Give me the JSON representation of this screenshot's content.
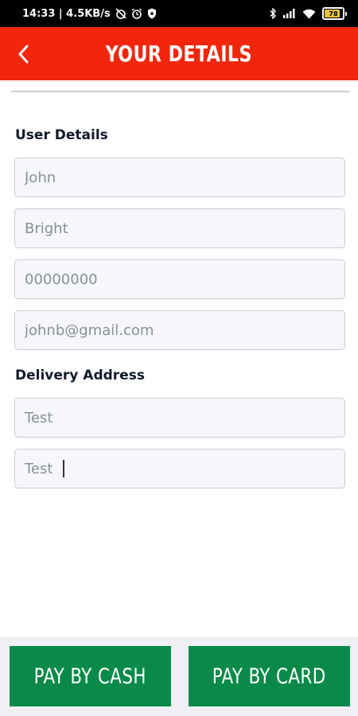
{
  "status_bar": {
    "time_speed": "14:33 | 4.5KB/s",
    "battery": "78",
    "icons": [
      "alarm-off-icon",
      "alarm-icon",
      "shield-icon",
      "bluetooth-icon",
      "signal-icon",
      "wifi-icon",
      "battery-icon"
    ]
  },
  "header": {
    "title": "YOUR DETAILS",
    "back_icon": "chevron-left-icon",
    "background": "#f1260c"
  },
  "user_details": {
    "heading": "User Details",
    "first_name": "John",
    "last_name": "Bright",
    "phone": "00000000",
    "email": "johnb@gmail.com"
  },
  "delivery_address": {
    "heading": "Delivery Address",
    "line1": "Test",
    "line2": "Test"
  },
  "actions": {
    "pay_cash": "PAY BY CASH",
    "pay_card": "PAY BY CARD",
    "button_color": "#0a8a49"
  },
  "battery_level": 0.78
}
